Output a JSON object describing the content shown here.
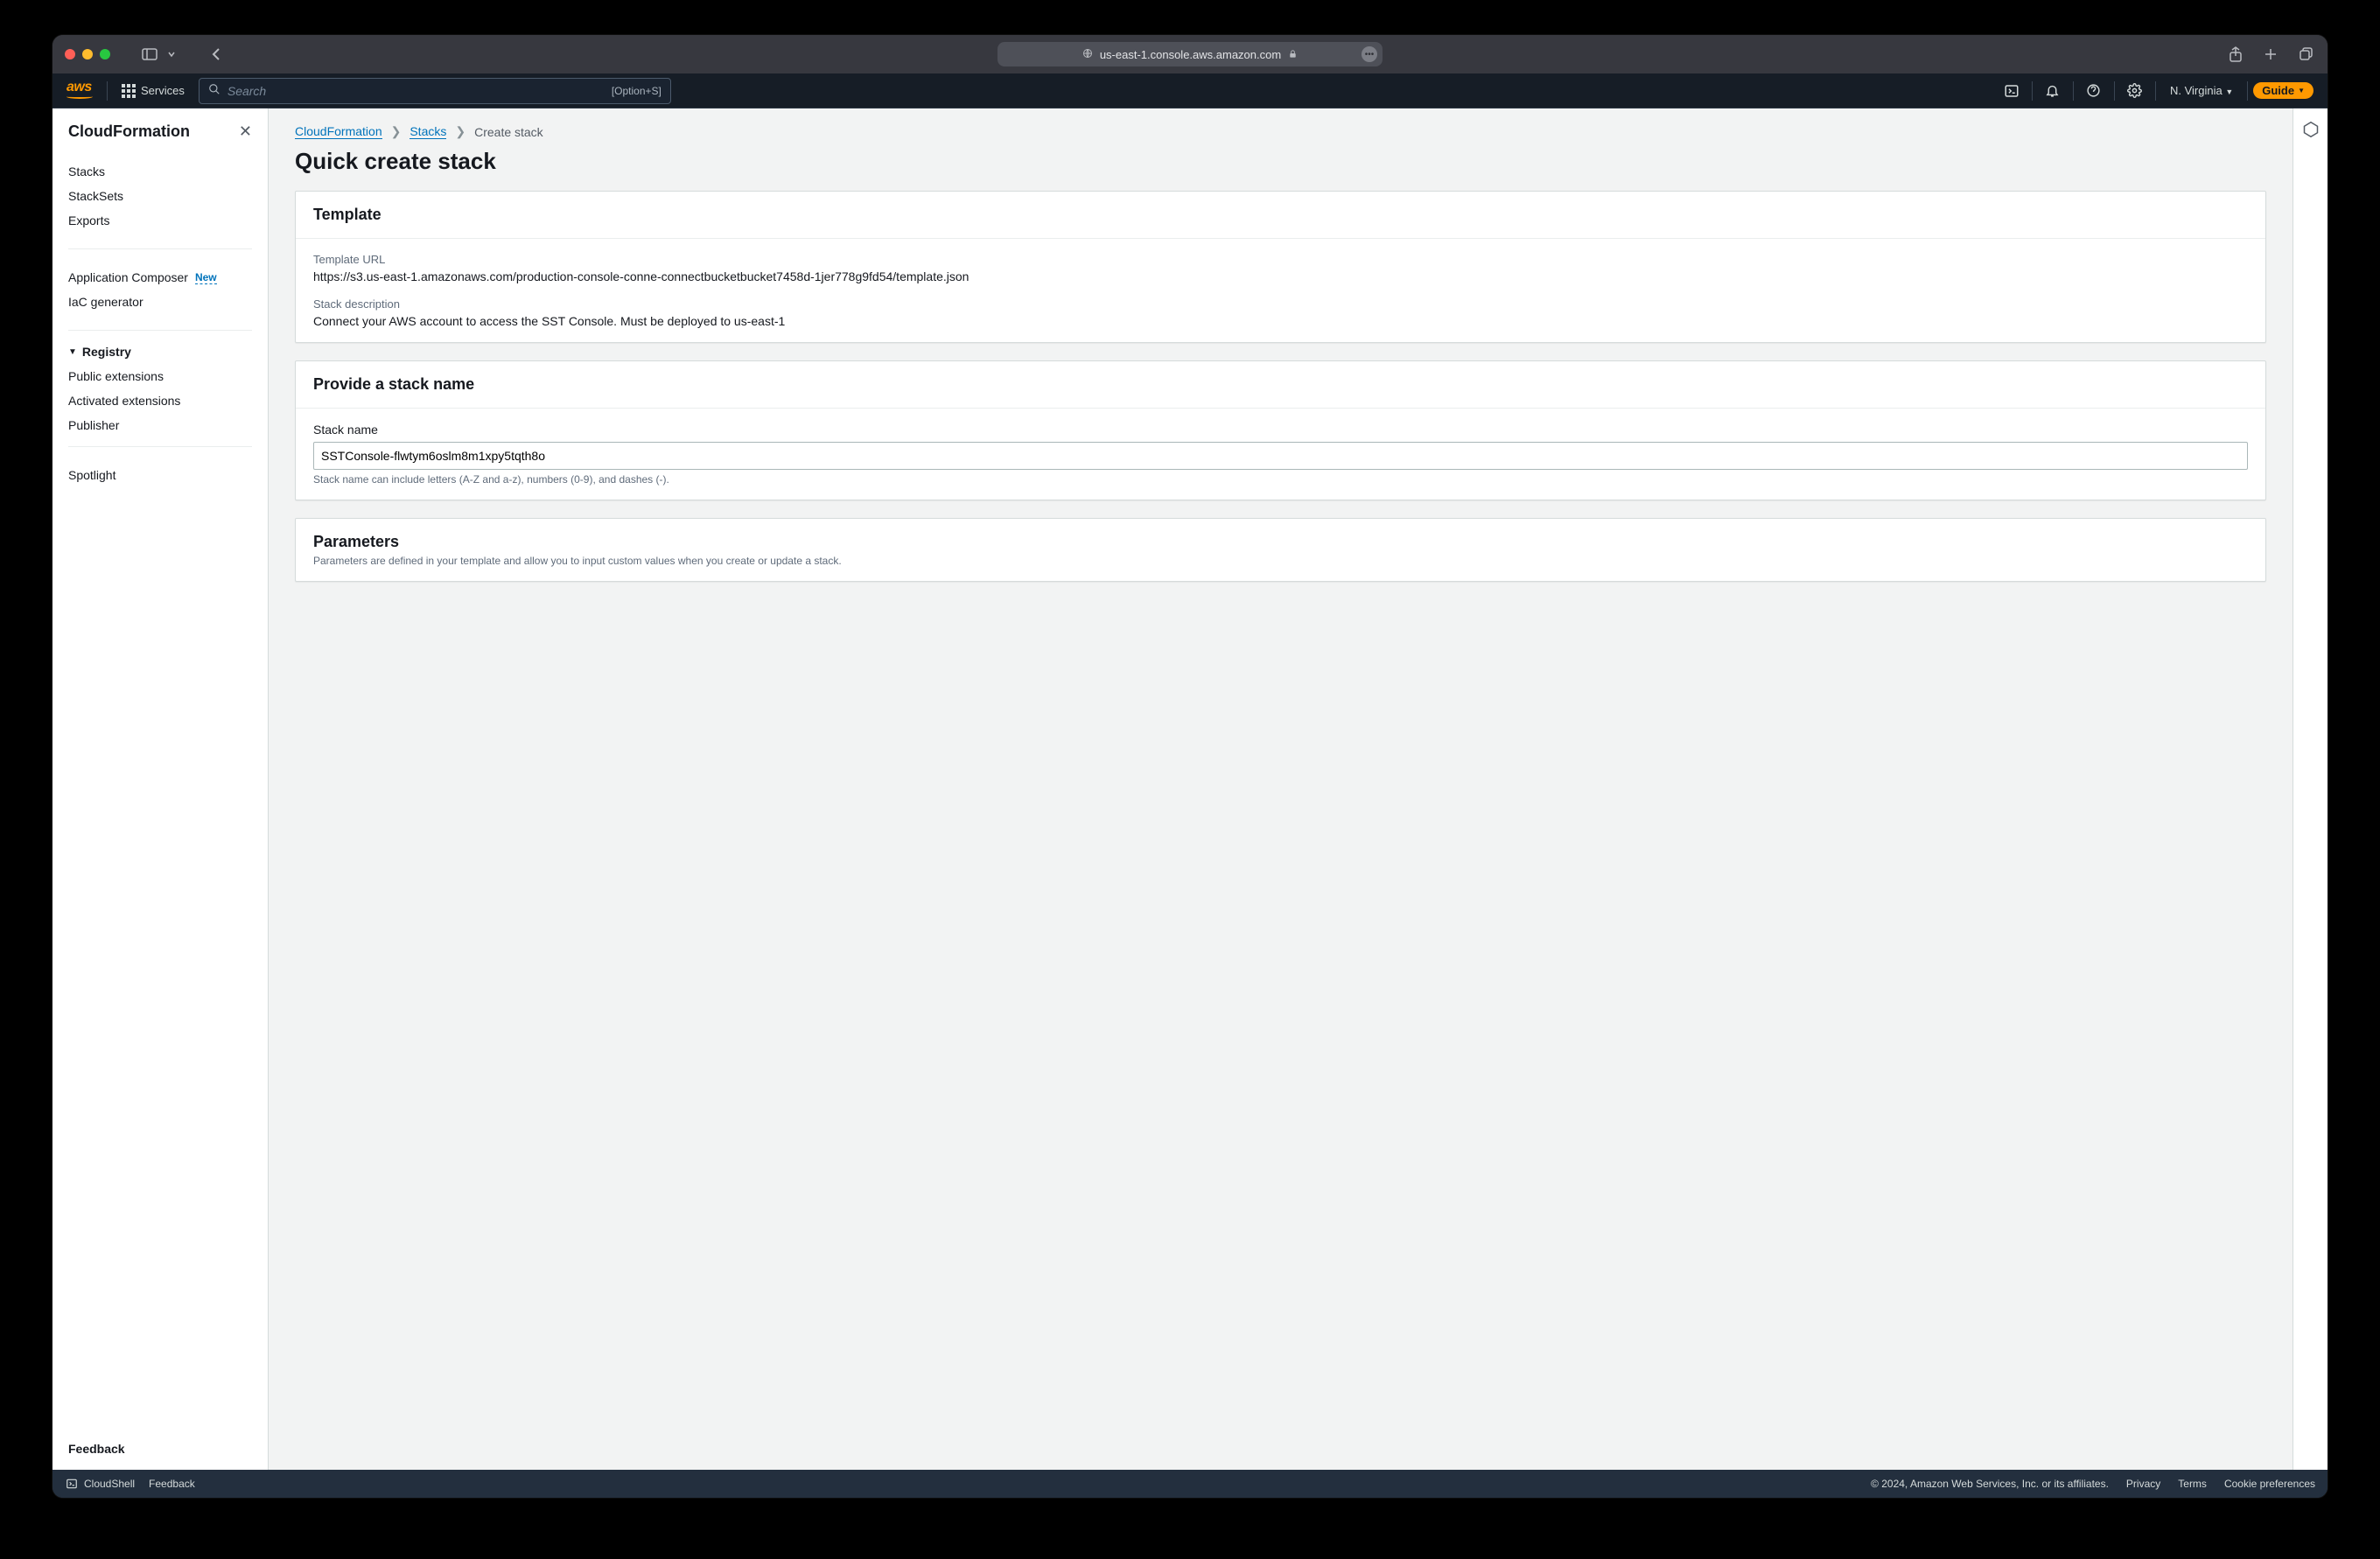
{
  "browser": {
    "url_host": "us-east-1.console.aws.amazon.com"
  },
  "topnav": {
    "services_label": "Services",
    "search_placeholder": "Search",
    "search_shortcut": "[Option+S]",
    "region": "N. Virginia",
    "guide_label": "Guide"
  },
  "sidebar": {
    "title": "CloudFormation",
    "items_a": [
      "Stacks",
      "StackSets",
      "Exports"
    ],
    "app_composer": "Application Composer",
    "new_badge": "New",
    "iac": "IaC generator",
    "registry_label": "Registry",
    "registry_items": [
      "Public extensions",
      "Activated extensions",
      "Publisher"
    ],
    "spotlight": "Spotlight",
    "feedback": "Feedback"
  },
  "breadcrumb": {
    "a": "CloudFormation",
    "b": "Stacks",
    "c": "Create stack"
  },
  "page": {
    "title": "Quick create stack"
  },
  "template_panel": {
    "heading": "Template",
    "url_label": "Template URL",
    "url_value": "https://s3.us-east-1.amazonaws.com/production-console-conne-connectbucketbucket7458d-1jer778g9fd54/template.json",
    "desc_label": "Stack description",
    "desc_value": "Connect your AWS account to access the SST Console. Must be deployed to us-east-1"
  },
  "stackname_panel": {
    "heading": "Provide a stack name",
    "label": "Stack name",
    "value": "SSTConsole-flwtym6oslm8m1xpy5tqth8o",
    "hint": "Stack name can include letters (A-Z and a-z), numbers (0-9), and dashes (-)."
  },
  "params_panel": {
    "heading": "Parameters",
    "desc": "Parameters are defined in your template and allow you to input custom values when you create or update a stack."
  },
  "footer": {
    "cloudshell": "CloudShell",
    "feedback": "Feedback",
    "copyright": "© 2024, Amazon Web Services, Inc. or its affiliates.",
    "privacy": "Privacy",
    "terms": "Terms",
    "cookies": "Cookie preferences"
  }
}
